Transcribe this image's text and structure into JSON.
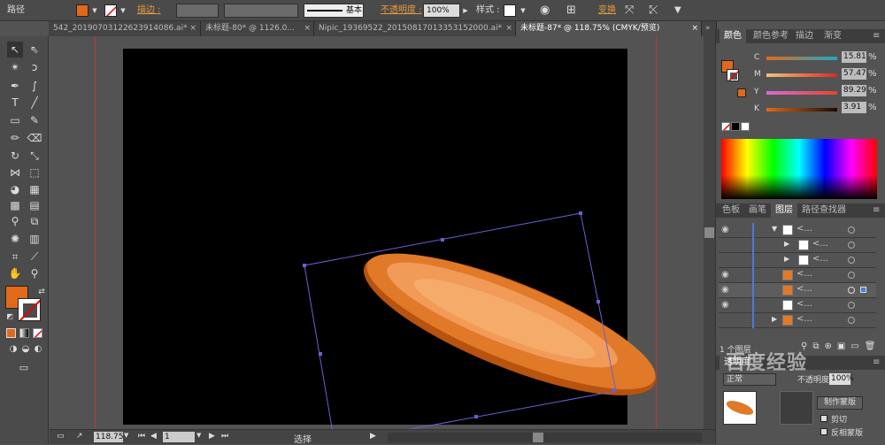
{
  "control_bar": {
    "path_label": "路径",
    "stroke_label": "描边 :",
    "stroke_style": "基本",
    "opacity_label": "不透明度 :",
    "opacity_value": "100%",
    "style_label": "样式 :",
    "transform_label": "变换",
    "fill_color": "#e06a1a"
  },
  "tabs": [
    {
      "label": "542_20190703122623914086.ai* ×"
    },
    {
      "label": "未标题-80* @ 1126.0..."
    },
    {
      "label": "Nipic_19369522_20150817013353152000.ai*"
    },
    {
      "label": "未标题-87* @ 118.75% (CMYK/预览)"
    }
  ],
  "toolbar": {
    "fill_color": "#e06a1a"
  },
  "color_panel": {
    "tabs": [
      "颜色",
      "颜色参考",
      "描边",
      "渐变"
    ],
    "sliders": [
      {
        "label": "C",
        "value": "15.81",
        "unit": "%"
      },
      {
        "label": "M",
        "value": "57.47",
        "unit": "%"
      },
      {
        "label": "Y",
        "value": "89.29",
        "unit": "%"
      },
      {
        "label": "K",
        "value": "3.91",
        "unit": "%"
      }
    ],
    "fill_color": "#e06a1a"
  },
  "layers_panel": {
    "tabs": [
      "色板",
      "画笔",
      "图层",
      "路径查找器"
    ],
    "rows": [
      {
        "name": "<..."
      },
      {
        "name": "<..."
      },
      {
        "name": "<..."
      },
      {
        "name": "<..."
      },
      {
        "name": "<..."
      },
      {
        "name": "<..."
      },
      {
        "name": "<..."
      }
    ],
    "footer": "1 个图层"
  },
  "transparency_panel": {
    "title": "透明度",
    "mode": "正常",
    "opacity": "100%",
    "make_mask": "制作蒙版",
    "clip": "剪切",
    "invert": "反相蒙版"
  },
  "status_bar": {
    "zoom": "118.75",
    "page": "1",
    "mode": "选择"
  },
  "watermark": "百度经验"
}
